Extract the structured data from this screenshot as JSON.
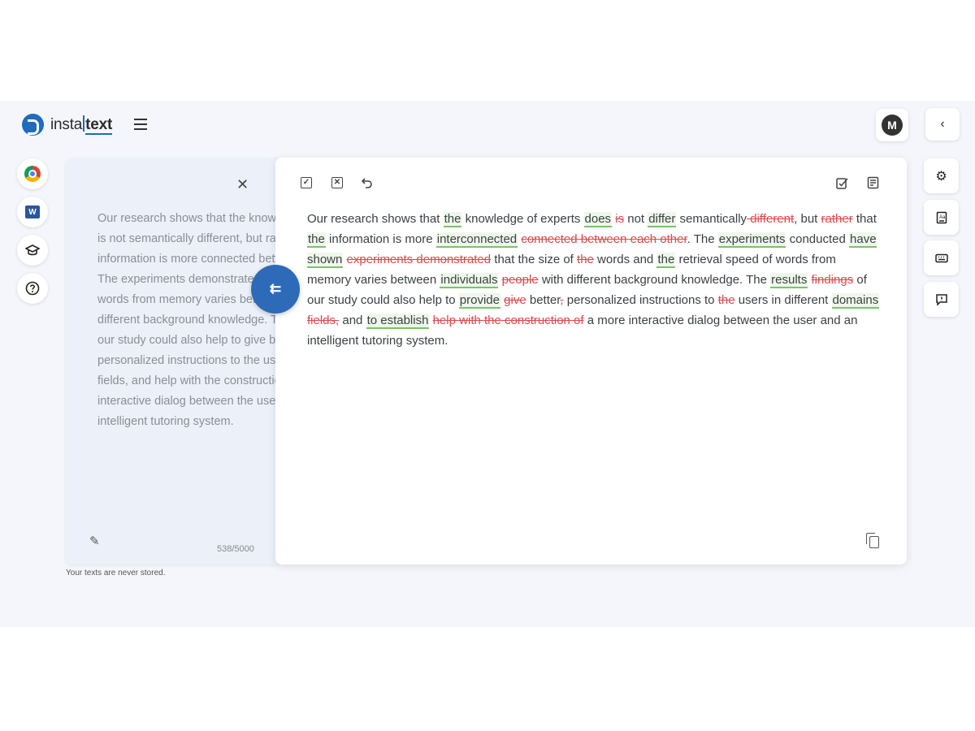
{
  "brand": {
    "prefix": "insta",
    "suffix": "text"
  },
  "header": {
    "avatar_initial": "M",
    "collapse_icon": "‹"
  },
  "side_icons": [
    "chrome-icon",
    "word-icon",
    "graduation-cap-icon",
    "help-icon"
  ],
  "source": {
    "text": "Our research shows that the knowledge of experts is not semantically different, but rather that the information is more connected between each other. The experiments demonstrated that the size of the words from memory varies between people with different background knowledge. The findings of our study could also help to give better, personalized instructions to the users in different fields, and help with the construction of a more interactive dialog between the user and an intelligent tutoring system.",
    "char_count": "538/5000",
    "footnote": "Your texts are never stored."
  },
  "swap_button_label": "⇇",
  "result": {
    "segments": [
      {
        "t": "Our research shows that ",
        "k": "n"
      },
      {
        "t": "the",
        "k": "i"
      },
      {
        "t": " knowledge of experts ",
        "k": "n"
      },
      {
        "t": "does",
        "k": "i"
      },
      {
        "t": " ",
        "k": "n"
      },
      {
        "t": "is",
        "k": "d"
      },
      {
        "t": " not ",
        "k": "n"
      },
      {
        "t": "differ",
        "k": "i"
      },
      {
        "t": " semantically",
        "k": "n"
      },
      {
        "t": " different",
        "k": "d"
      },
      {
        "t": ", but ",
        "k": "n"
      },
      {
        "t": "rather",
        "k": "d"
      },
      {
        "t": " that ",
        "k": "n"
      },
      {
        "t": "the",
        "k": "i"
      },
      {
        "t": " information is more ",
        "k": "n"
      },
      {
        "t": "interconnected",
        "k": "i"
      },
      {
        "t": " ",
        "k": "n"
      },
      {
        "t": "connected between each other",
        "k": "d"
      },
      {
        "t": ". The ",
        "k": "n"
      },
      {
        "t": "experiments",
        "k": "i"
      },
      {
        "t": " conducted ",
        "k": "n"
      },
      {
        "t": "have shown",
        "k": "i"
      },
      {
        "t": " ",
        "k": "n"
      },
      {
        "t": "experiments demonstrated",
        "k": "d"
      },
      {
        "t": " that the size of ",
        "k": "n"
      },
      {
        "t": "the",
        "k": "d"
      },
      {
        "t": " words and ",
        "k": "n"
      },
      {
        "t": "the",
        "k": "i"
      },
      {
        "t": " retrieval speed of words from memory varies between ",
        "k": "n"
      },
      {
        "t": "individuals",
        "k": "i"
      },
      {
        "t": " ",
        "k": "n"
      },
      {
        "t": "people",
        "k": "d"
      },
      {
        "t": " with different background knowledge. The ",
        "k": "n"
      },
      {
        "t": "results",
        "k": "i"
      },
      {
        "t": " ",
        "k": "n"
      },
      {
        "t": "findings",
        "k": "d"
      },
      {
        "t": " of our study could also help to ",
        "k": "n"
      },
      {
        "t": "provide",
        "k": "i"
      },
      {
        "t": " ",
        "k": "n"
      },
      {
        "t": "give",
        "k": "d"
      },
      {
        "t": " better",
        "k": "n"
      },
      {
        "t": ",",
        "k": "d"
      },
      {
        "t": " personalized instructions to ",
        "k": "n"
      },
      {
        "t": "the",
        "k": "d"
      },
      {
        "t": " users in different ",
        "k": "n"
      },
      {
        "t": "domains",
        "k": "i"
      },
      {
        "t": " ",
        "k": "n"
      },
      {
        "t": "fields,",
        "k": "d"
      },
      {
        "t": " and ",
        "k": "n"
      },
      {
        "t": "to establish",
        "k": "i"
      },
      {
        "t": " ",
        "k": "n"
      },
      {
        "t": "help with the construction of",
        "k": "d"
      },
      {
        "t": " a more interactive dialog between the user and an intelligent tutoring system.",
        "k": "n"
      }
    ]
  },
  "toolbar_icons": [
    "accept-all-icon",
    "reject-all-icon",
    "undo-icon",
    "check-list-icon",
    "summary-icon"
  ],
  "right_tools": [
    "settings-icon",
    "dictionary-icon",
    "keyboard-icon",
    "feedback-icon"
  ],
  "colors": {
    "accent": "#2d6bb9",
    "insert": "#7ac26c",
    "delete": "#e0474c"
  }
}
